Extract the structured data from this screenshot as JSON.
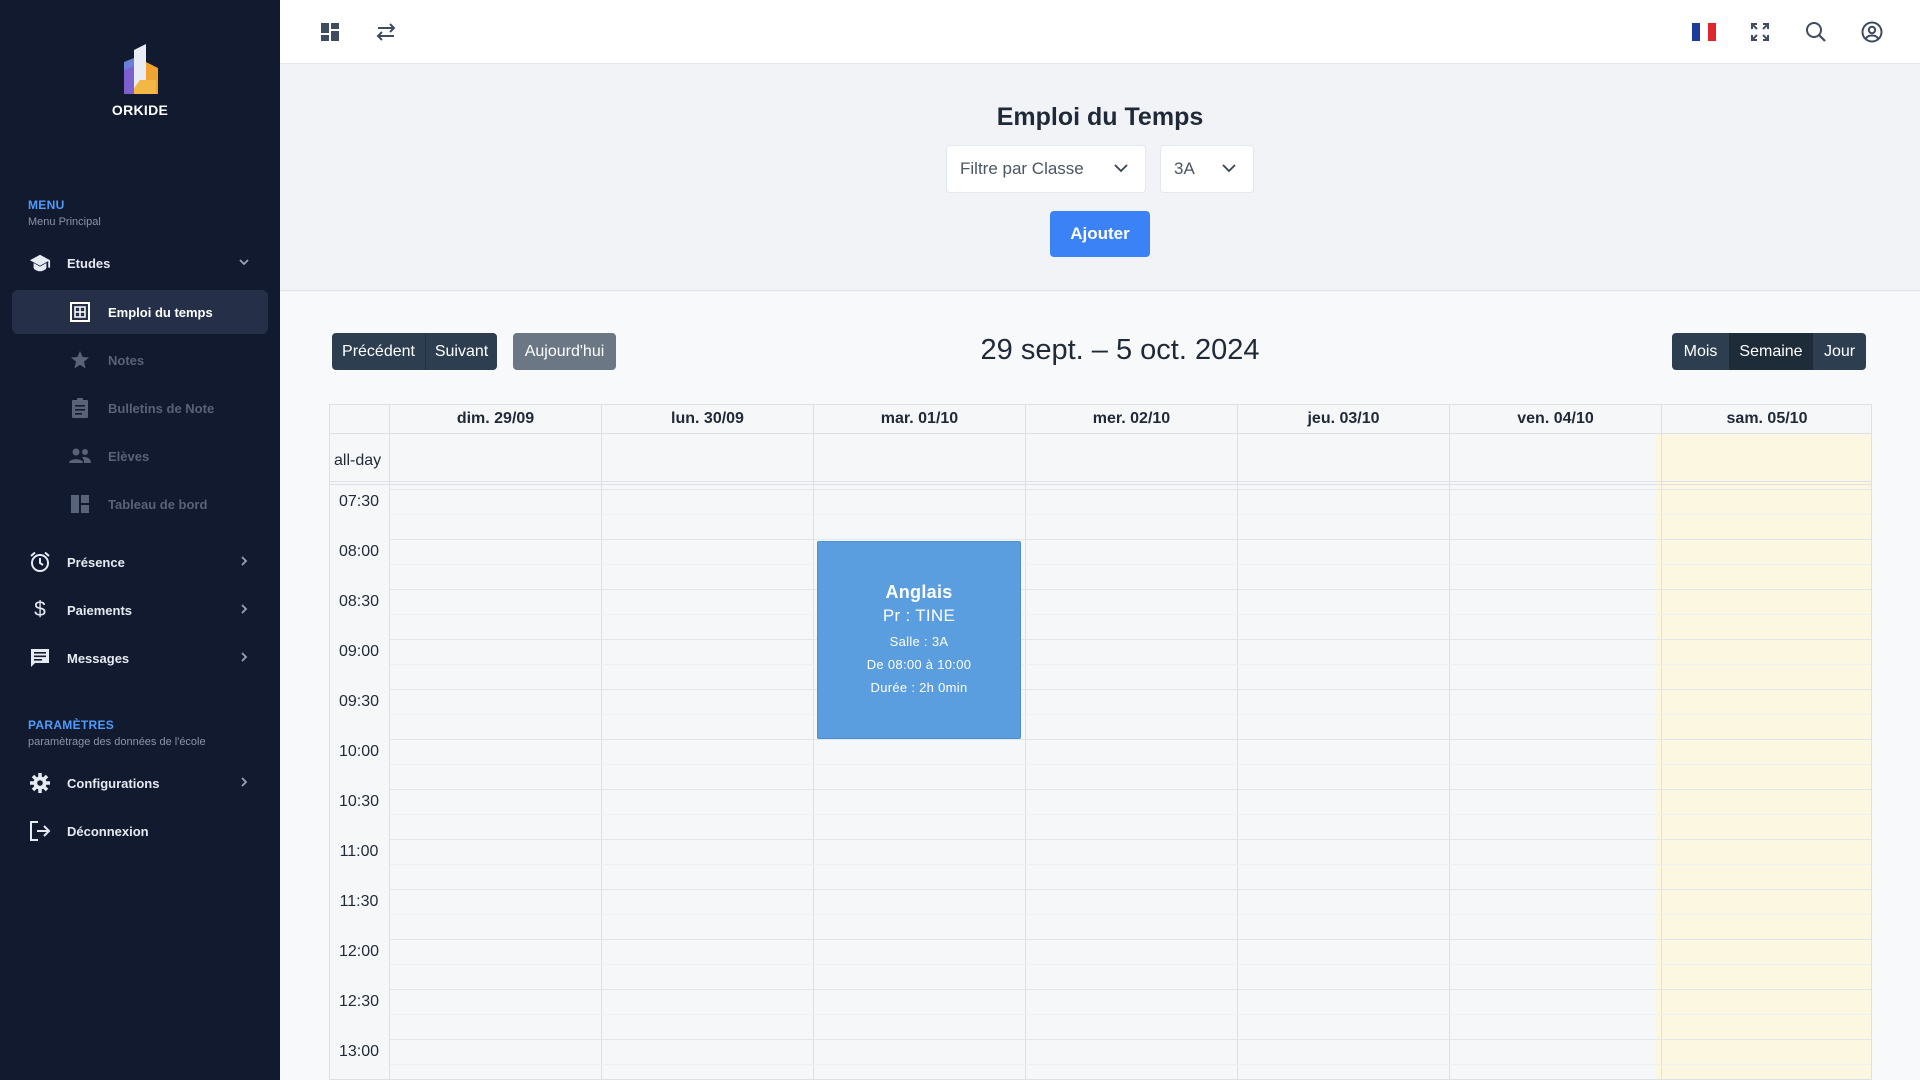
{
  "brand": {
    "name": "ORKIDE"
  },
  "sidebar": {
    "menu_title": "MENU",
    "menu_subtitle": "Menu Principal",
    "etudes": {
      "label": "Etudes",
      "icon": "graduation-cap-icon"
    },
    "etudes_items": [
      {
        "label": "Emploi du temps",
        "icon": "calendar-grid-icon",
        "active": true
      },
      {
        "label": "Notes",
        "icon": "star-icon"
      },
      {
        "label": "Bulletins de Note",
        "icon": "clipboard-icon"
      },
      {
        "label": "Elèves",
        "icon": "people-icon"
      },
      {
        "label": "Tableau de bord",
        "icon": "dashboard-icon"
      }
    ],
    "items": [
      {
        "label": "Présence",
        "icon": "alarm-clock-icon"
      },
      {
        "label": "Paiements",
        "icon": "dollar-icon"
      },
      {
        "label": "Messages",
        "icon": "message-icon"
      }
    ],
    "settings_title": "PARAMÈTRES",
    "settings_subtitle": "paramètrage des données de l'école",
    "configurations": {
      "label": "Configurations",
      "icon": "gear-icon"
    },
    "logout": {
      "label": "Déconnexion",
      "icon": "logout-icon"
    }
  },
  "header": {
    "title": "Emploi du Temps",
    "filter_placeholder": "Filtre par Classe",
    "class_value": "3A",
    "add_label": "Ajouter"
  },
  "calendar": {
    "prev_label": "Précédent",
    "next_label": "Suivant",
    "today_label": "Aujourd'hui",
    "range_title": "29 sept. – 5 oct. 2024",
    "views": [
      "Mois",
      "Semaine",
      "Jour"
    ],
    "active_view": "Semaine",
    "days": [
      "dim. 29/09",
      "lun. 30/09",
      "mar. 01/10",
      "mer. 02/10",
      "jeu. 03/10",
      "ven. 04/10",
      "sam. 05/10"
    ],
    "today_index": 6,
    "allday_label": "all-day",
    "times": [
      "07:30",
      "08:00",
      "08:30",
      "09:00",
      "09:30",
      "10:00",
      "10:30",
      "11:00",
      "11:30",
      "12:00",
      "12:30",
      "13:00"
    ],
    "colors": {
      "event": "#5b9ee0",
      "today": "#fbf7e0",
      "dark_button": "#2c3e50"
    },
    "event": {
      "day_index": 2,
      "start": "08:00",
      "end": "10:00",
      "title": "Anglais",
      "prof": "Pr : TINE",
      "room": "Salle : 3A",
      "span": "De 08:00 à 10:00",
      "duration": "Durée : 2h 0min"
    }
  }
}
